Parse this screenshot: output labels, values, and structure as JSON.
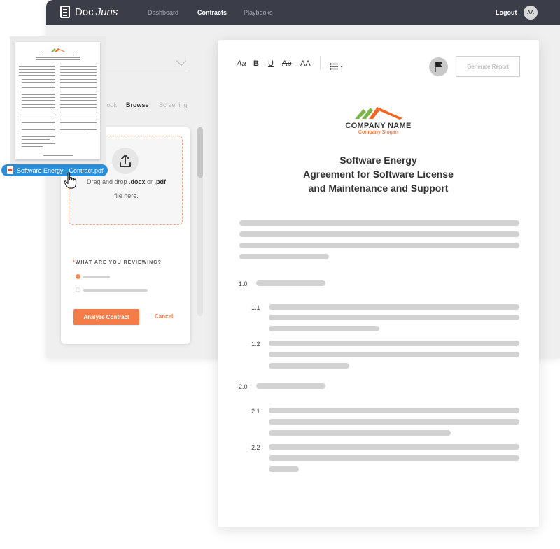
{
  "app": {
    "logo_doc": "Doc",
    "logo_juris": "Juris",
    "nav": [
      "Dashboard",
      "Contracts",
      "Playbooks"
    ],
    "active_nav": "Contracts",
    "logout": "Logout",
    "avatar_initials": "AA"
  },
  "sidebar": {
    "tabs": [
      "Playbook",
      "Browse",
      "Screening"
    ],
    "tab_visible_text": [
      "ybook",
      "Browse",
      "Screening"
    ],
    "active_tab": "Browse"
  },
  "upload": {
    "drag_prefix": "Drag and drop ",
    "docx": ".docx",
    "or": " or ",
    "pdf": ".pdf",
    "file_here": "file here.",
    "review_required_mark": "*",
    "review_label": "WHAT ARE YOU REVIEWING?",
    "analyze": "Analyze Contract",
    "cancel": "Cancel"
  },
  "editor": {
    "toolbar": {
      "font": "Aa",
      "bold": "B",
      "underline": "U",
      "strike": "Ab",
      "caps": "AA"
    },
    "generate_report": "Generate Report",
    "company_name": "COMPANY NAME",
    "company_slogan": "Company Slogan",
    "title_line1": "Software Energy",
    "title_line2": "Agreement for Software License",
    "title_line3": "and Maintenance and Support",
    "sections": [
      "1.0",
      "1.1",
      "1.2",
      "2.0",
      "2.1",
      "2.2"
    ]
  },
  "drag": {
    "file_name": "Software Energy - Contract.pdf"
  },
  "colors": {
    "topbar": "#3b3e48",
    "accent": "#f47c48",
    "chip": "#2a8ed8",
    "logo_green": "#7ab648",
    "logo_orange": "#f26522"
  }
}
